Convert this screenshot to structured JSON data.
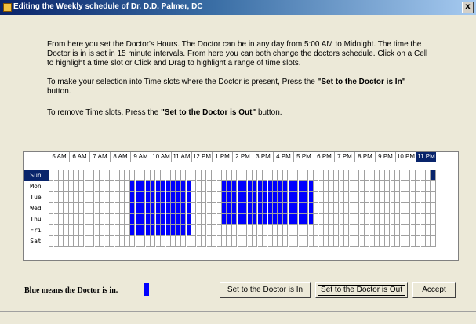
{
  "window": {
    "title": "Editing the Weekly schedule of Dr. D.D. Palmer, DC",
    "close_symbol": "x"
  },
  "instructions": {
    "paragraph1": "From here you set the Doctor's Hours. The Doctor can be in any day from 5:00 AM to Midnight. The time the Doctor is in is set in 15 minute intervals. From here you can both change the doctors schedule.  Click on a Cell to highlight a time slot or Click and Drag to highlight a range of time slots.",
    "paragraph2_prefix": "To make your selection into Time slots where the Doctor is present, Press the ",
    "paragraph2_bold": "\"Set to the Doctor is In\"",
    "paragraph2_suffix": " button.",
    "paragraph3_prefix": "To remove Time slots, Press the ",
    "paragraph3_bold": "\"Set to the Doctor is Out\"",
    "paragraph3_suffix": " button."
  },
  "schedule": {
    "hours": [
      "5 AM",
      "6 AM",
      "7 AM",
      "8 AM",
      "9 AM",
      "10 AM",
      "11 AM",
      "12 PM",
      "1 PM",
      "2 PM",
      "3 PM",
      "4 PM",
      "5 PM",
      "6 PM",
      "7 PM",
      "8 PM",
      "9 PM",
      "10 PM",
      "11 PM"
    ],
    "selected_hour": "11 PM",
    "days": [
      "Sun",
      "Mon",
      "Tue",
      "Wed",
      "Thu",
      "Fri",
      "Sat"
    ],
    "selected_day": "Sun",
    "slots_per_hour": 4,
    "doctor_in": {
      "days": [
        "Mon",
        "Tue",
        "Wed",
        "Thu",
        "Fri"
      ],
      "morning": {
        "start": "9:00 AM",
        "end": "12:00 PM"
      },
      "afternoon": {
        "start": "1:30 PM",
        "end": "6:00 PM",
        "days": [
          "Mon",
          "Tue",
          "Wed",
          "Thu"
        ]
      }
    },
    "in_color": "#0000ff",
    "selection_color": "#08246b"
  },
  "legend": {
    "label": "Blue means the Doctor is in."
  },
  "buttons": {
    "set_in": "Set to the Doctor is In",
    "set_out": "Set to the Doctor is Out",
    "accept": "Accept"
  }
}
